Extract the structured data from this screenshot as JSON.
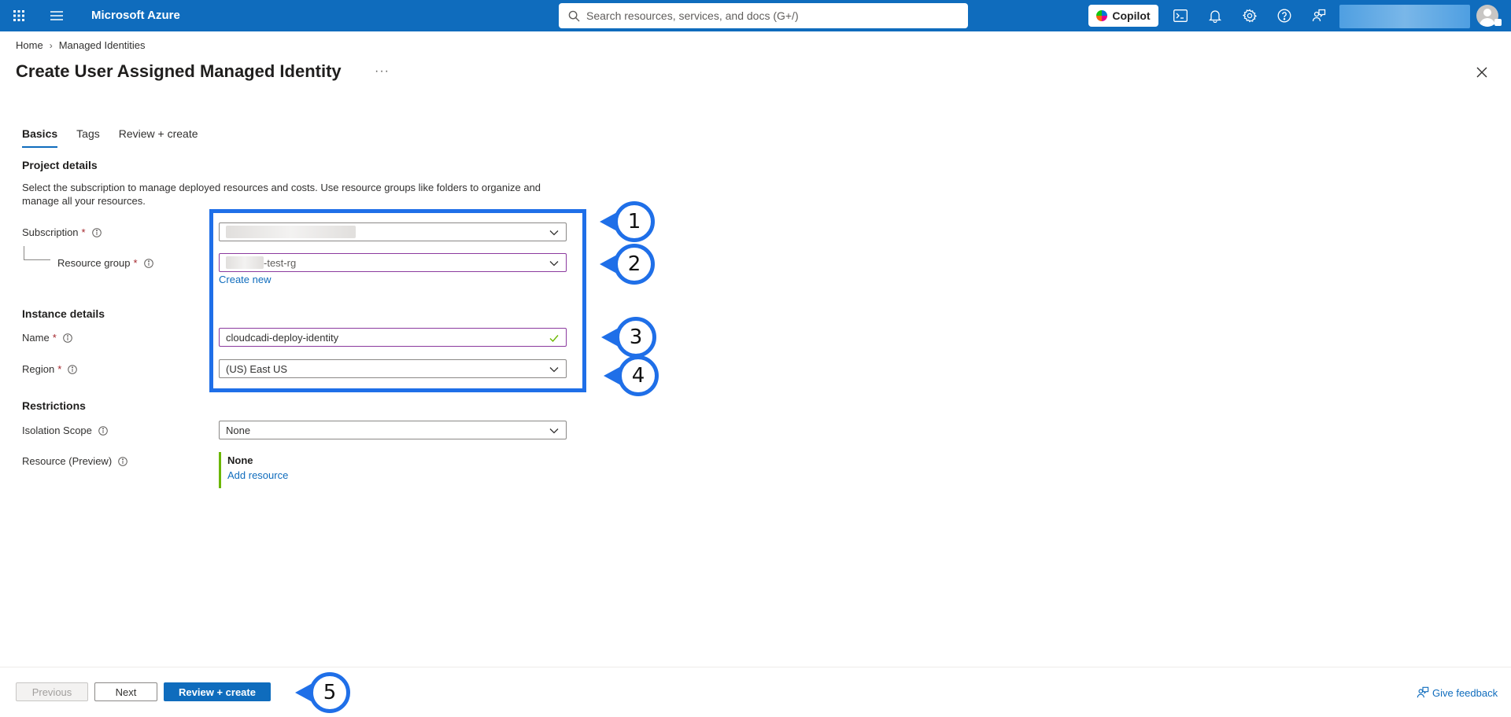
{
  "topbar": {
    "brand": "Microsoft Azure",
    "search_placeholder": "Search resources, services, and docs (G+/)",
    "copilot_label": "Copilot"
  },
  "breadcrumb": {
    "home": "Home",
    "current": "Managed Identities"
  },
  "page": {
    "title": "Create User Assigned Managed Identity",
    "more": "···"
  },
  "tabs": [
    {
      "label": "Basics"
    },
    {
      "label": "Tags"
    },
    {
      "label": "Review + create"
    }
  ],
  "project": {
    "title": "Project details",
    "description": "Select the subscription to manage deployed resources and costs. Use resource groups like folders to organize and manage all your resources.",
    "subscription_label": "Subscription",
    "resource_group_label": "Resource group",
    "resource_group_value": "-test-rg",
    "create_new": "Create new"
  },
  "instance": {
    "title": "Instance details",
    "name_label": "Name",
    "name_value": "cloudcadi-deploy-identity",
    "region_label": "Region",
    "region_value": "(US) East US"
  },
  "restrictions": {
    "title": "Restrictions",
    "isolation_label": "Isolation Scope",
    "isolation_value": "None",
    "resource_label": "Resource (Preview)",
    "resource_value": "None",
    "add_resource": "Add resource"
  },
  "required_mark": "*",
  "callouts": [
    "1",
    "2",
    "3",
    "4",
    "5"
  ],
  "footer": {
    "previous": "Previous",
    "next": "Next",
    "review": "Review + create",
    "feedback": "Give feedback"
  },
  "colors": {
    "azure_blue": "#0f6cbd",
    "annotation_blue": "#1f6fe8",
    "valid_green": "#6bb700",
    "required_red": "#a4262c"
  },
  "icons": [
    "waffle-icon",
    "hamburger-icon",
    "search-icon",
    "terminal-icon",
    "bell-icon",
    "gear-icon",
    "help-icon",
    "feedback-icon",
    "info-icon",
    "chevron-down-icon",
    "check-icon",
    "close-icon"
  ]
}
